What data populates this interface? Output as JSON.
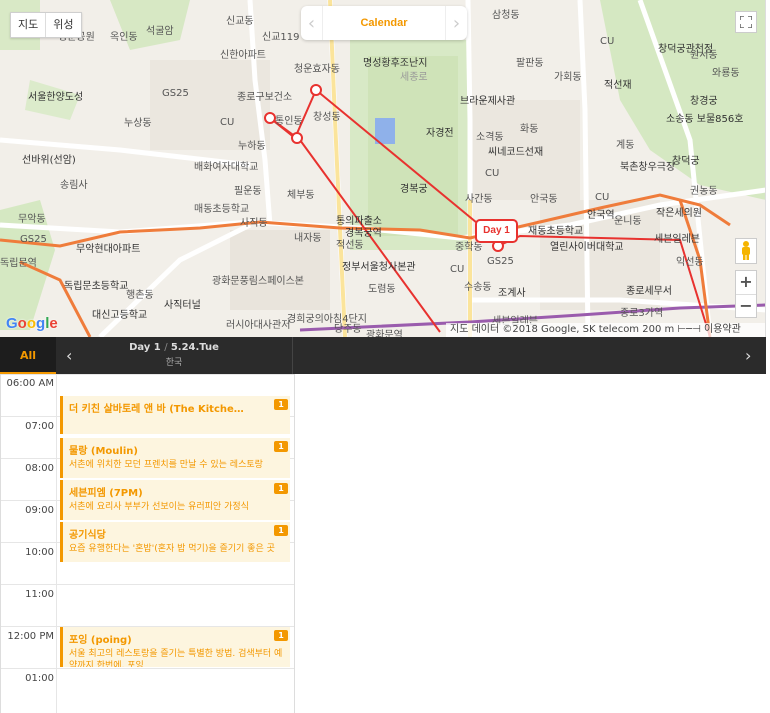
{
  "map": {
    "type_tabs": [
      "지도",
      "위성"
    ],
    "calendar_title": "Calendar",
    "day_marker": "Day 1",
    "google_logo": "Google",
    "attribution": "지도 데이터 ©2018 Google, SK telecom   200 m ⊢─⊣   이용약관",
    "labels": [
      "석굴암",
      "신교동",
      "신교119",
      "청운공원",
      "옥인동",
      "서울한양도성",
      "신한아파트",
      "GS25",
      "종로구보건소",
      "CU",
      "누상동",
      "누하동",
      "배화여자대학교",
      "통인동",
      "창성동",
      "선바위(선암)",
      "송림사",
      "매동초등학교",
      "필운동",
      "체부동",
      "무악동",
      "사직동",
      "내자동",
      "적선동",
      "GS25",
      "무악현대아파트",
      "독립문역",
      "독립문초등학교",
      "행촌동",
      "사직터널",
      "광화문풍림스페이스본",
      "대신고등학교",
      "러시아대사관저",
      "당주동",
      "경희궁의아침4단지",
      "명성황후조난지",
      "세종로",
      "브라운제사관",
      "자경전",
      "소격동",
      "씨네코드선재",
      "CU",
      "경복궁",
      "사간동",
      "통의파출소",
      "경복궁역",
      "정부서울청사본관",
      "CU",
      "GS25",
      "조계사",
      "수송동",
      "도렴동",
      "광화문역",
      "세븐일레븐",
      "중학동",
      "안국역",
      "열린사이버대학교",
      "재동초등학교",
      "창덕궁",
      "창덕궁관천정",
      "창경궁",
      "소송동 보물856호",
      "북촌창우극장",
      "종로세무서",
      "세븐일레븐",
      "종로3가역",
      "작은세의원",
      "권농동",
      "익선동",
      "가회동",
      "원서동",
      "계동",
      "운니동",
      "CU",
      "CU",
      "적선재",
      "와룡동",
      "팔판동",
      "삼청동",
      "화동",
      "안국동",
      "청운효자동"
    ]
  },
  "day": {
    "all_label": "All",
    "prev": "‹",
    "next": "›",
    "title": "Day 1",
    "date": "5.24.Tue",
    "country": "한국"
  },
  "timeline": {
    "hours": [
      "06:00 AM",
      "07:00",
      "08:00",
      "09:00",
      "10:00",
      "11:00",
      "12:00 PM",
      "01:00"
    ],
    "events": [
      {
        "name": "더 키친 살바토레 앤 바 (The Kitche…",
        "desc": "",
        "badge": "1"
      },
      {
        "name": "물랑 (Moulin)",
        "desc": "서촌에 위치한 모던 프렌치를 만날 수 있는 레스토랑",
        "badge": "1"
      },
      {
        "name": "세븐피엠 (7PM)",
        "desc": "서촌에 요리사 부부가 선보이는 유러피안 가정식",
        "badge": "1"
      },
      {
        "name": "공기식당",
        "desc": "요즘 유행한다는 '혼밥'(혼자 밥 먹기)을 즐기기 좋은 곳",
        "badge": "1"
      },
      {
        "name": "포잉 (poing)",
        "desc": "서울 최고의 레스토랑을 즐기는 특별한 방법. 검색부터 예약까지 한번에, 포잉",
        "badge": "1"
      }
    ]
  },
  "colors": {
    "accent": "#f39800",
    "route": "#e8322f",
    "header_bg": "#2b2b2b"
  }
}
